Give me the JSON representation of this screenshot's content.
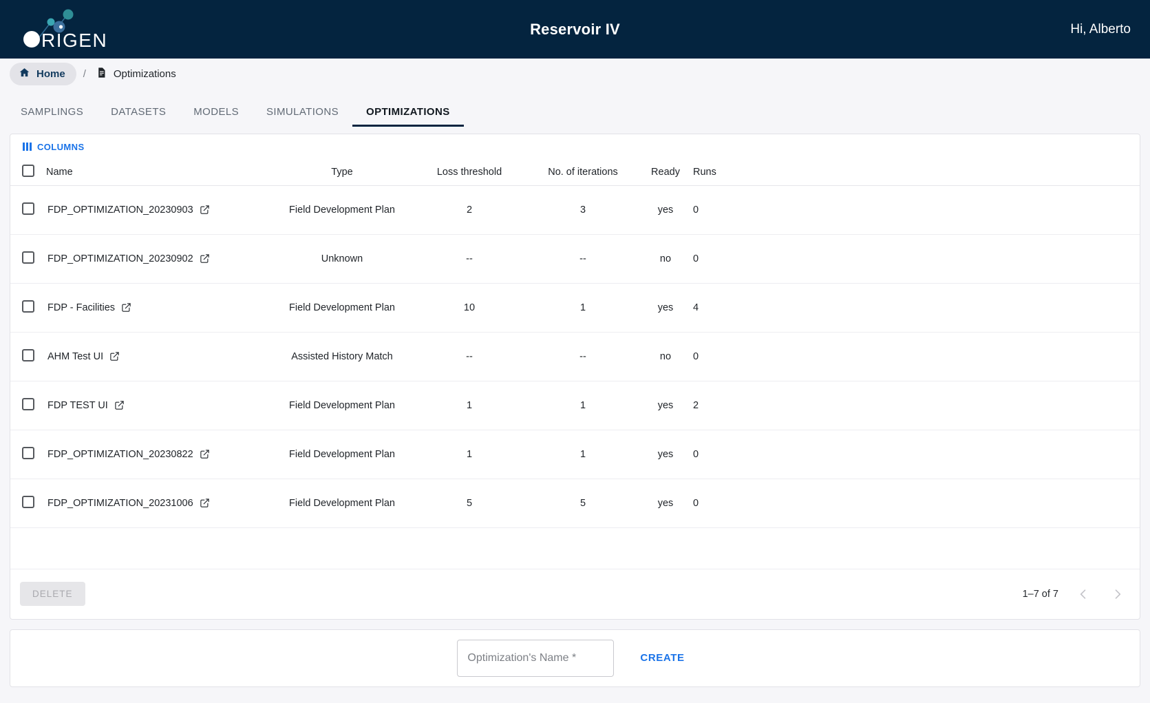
{
  "header": {
    "logo_text": "ORIGEN",
    "app_title": "Reservoir IV",
    "greeting": "Hi, Alberto"
  },
  "breadcrumb": {
    "home_label": "Home",
    "separator": "/",
    "current_label": "Optimizations"
  },
  "tabs": [
    {
      "label": "SAMPLINGS",
      "active": false
    },
    {
      "label": "DATASETS",
      "active": false
    },
    {
      "label": "MODELS",
      "active": false
    },
    {
      "label": "SIMULATIONS",
      "active": false
    },
    {
      "label": "OPTIMIZATIONS",
      "active": true
    }
  ],
  "toolbar": {
    "columns_label": "COLUMNS"
  },
  "table": {
    "columns": [
      "Name",
      "Type",
      "Loss threshold",
      "No. of iterations",
      "Ready",
      "Runs"
    ],
    "rows": [
      {
        "name": "FDP_OPTIMIZATION_20230903",
        "type": "Field Development Plan",
        "loss_threshold": "2",
        "iterations": "3",
        "ready": "yes",
        "runs": "0"
      },
      {
        "name": "FDP_OPTIMIZATION_20230902",
        "type": "Unknown",
        "loss_threshold": "--",
        "iterations": "--",
        "ready": "no",
        "runs": "0"
      },
      {
        "name": "FDP - Facilities",
        "type": "Field Development Plan",
        "loss_threshold": "10",
        "iterations": "1",
        "ready": "yes",
        "runs": "4"
      },
      {
        "name": "AHM Test UI",
        "type": "Assisted History Match",
        "loss_threshold": "--",
        "iterations": "--",
        "ready": "no",
        "runs": "0"
      },
      {
        "name": "FDP TEST UI",
        "type": "Field Development Plan",
        "loss_threshold": "1",
        "iterations": "1",
        "ready": "yes",
        "runs": "2"
      },
      {
        "name": "FDP_OPTIMIZATION_20230822",
        "type": "Field Development Plan",
        "loss_threshold": "1",
        "iterations": "1",
        "ready": "yes",
        "runs": "0"
      },
      {
        "name": "FDP_OPTIMIZATION_20231006",
        "type": "Field Development Plan",
        "loss_threshold": "5",
        "iterations": "5",
        "ready": "yes",
        "runs": "0"
      }
    ]
  },
  "footer": {
    "delete_label": "DELETE",
    "pagination_label": "1–7 of 7"
  },
  "create": {
    "input_value": "",
    "input_placeholder": "Optimization's Name *",
    "button_label": "CREATE"
  },
  "colors": {
    "header_bg": "#04243f",
    "accent_blue": "#1a73e8",
    "page_bg": "#f6f6f9",
    "tab_active": "#11181f"
  }
}
